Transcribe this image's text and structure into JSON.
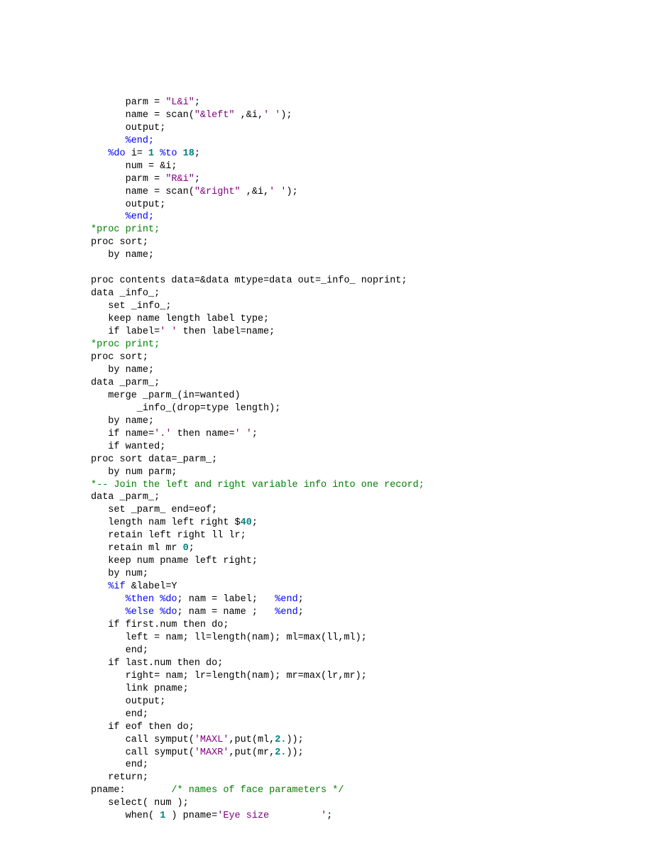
{
  "code": {
    "l01a": "      parm = ",
    "l01b": "\"L&i\"",
    "l01c": ";",
    "l02a": "      name = scan(",
    "l02b": "\"&left\"",
    "l02c": " ,&i,",
    "l02d": "' '",
    "l02e": ");",
    "l03": "      output;",
    "l04": "      %end;",
    "l05a": "   %do",
    "l05b": " i= ",
    "l05c": "1",
    "l05d": " %to",
    "l05e": " ",
    "l05f": "18",
    "l05g": ";",
    "l06": "      num = &i;",
    "l07a": "      parm = ",
    "l07b": "\"R&i\"",
    "l07c": ";",
    "l08a": "      name = scan(",
    "l08b": "\"&right\"",
    "l08c": " ,&i,",
    "l08d": "' '",
    "l08e": ");",
    "l09": "      output;",
    "l10": "      %end;",
    "l11": "*proc print;",
    "l12": "proc sort;",
    "l13": "   by name;",
    "l14": "",
    "l15": "proc contents data=&data mtype=data out=_info_ noprint;",
    "l16": "data _info_;",
    "l17": "   set _info_;",
    "l18": "   keep name length label type;",
    "l19a": "   if label=",
    "l19b": "' '",
    "l19c": " then label=name;",
    "l20": "*proc print;",
    "l21": "proc sort;",
    "l22": "   by name;",
    "l23": "data _parm_;",
    "l24": "   merge _parm_(in=wanted)",
    "l25": "        _info_(drop=type length);",
    "l26": "   by name;",
    "l27a": "   if name=",
    "l27b": "'.'",
    "l27c": " then name=",
    "l27d": "' '",
    "l27e": ";",
    "l28": "   if wanted;",
    "l29": "proc sort data=_parm_;",
    "l30": "   by num parm;",
    "l31": "*-- Join the left and right variable info into one record;",
    "l32": "data _parm_;",
    "l33": "   set _parm_ end=eof;",
    "l34a": "   length nam left right $",
    "l34b": "40",
    "l34c": ";",
    "l35": "   retain left right ll lr;",
    "l36a": "   retain ml mr ",
    "l36b": "0",
    "l36c": ";",
    "l37": "   keep num pname left right;",
    "l38": "   by num;",
    "l39a": "   %if",
    "l39b": " &label=Y",
    "l40a": "      %then",
    "l40b": " ",
    "l40c": "%do",
    "l40d": "; nam = label;   ",
    "l40e": "%end",
    "l40f": ";",
    "l41a": "      %else",
    "l41b": " ",
    "l41c": "%do",
    "l41d": "; nam = name ;   ",
    "l41e": "%end",
    "l41f": ";",
    "l42": "   if first.num then do;",
    "l43": "      left = nam; ll=length(nam); ml=max(ll,ml);",
    "l44": "      end;",
    "l45": "   if last.num then do;",
    "l46": "      right= nam; lr=length(nam); mr=max(lr,mr);",
    "l47": "      link pname;",
    "l48": "      output;",
    "l49": "      end;",
    "l50": "   if eof then do;",
    "l51a": "      call symput(",
    "l51b": "'MAXL'",
    "l51c": ",put(ml,",
    "l51d": "2.",
    "l51e": "));",
    "l52a": "      call symput(",
    "l52b": "'MAXR'",
    "l52c": ",put(mr,",
    "l52d": "2.",
    "l52e": "));",
    "l53": "      end;",
    "l54": "   return;",
    "l55a": "pname:        ",
    "l55b": "/* names of face parameters */",
    "l56": "   select( num );",
    "l57a": "      when( ",
    "l57b": "1",
    "l57c": " ) pname=",
    "l57d": "'Eye size         '",
    "l57e": ";"
  }
}
